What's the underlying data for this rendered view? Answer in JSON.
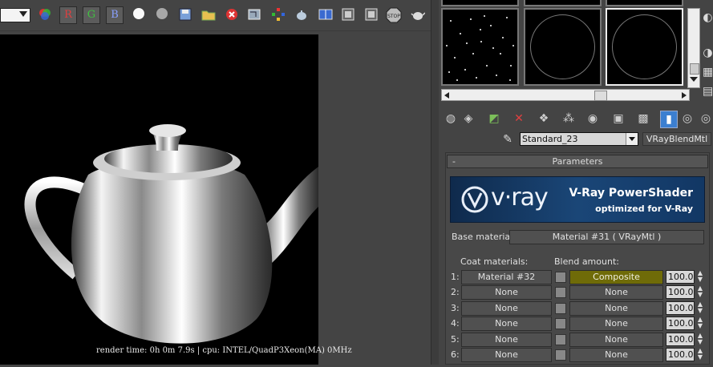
{
  "render_window": {
    "channels": {
      "r": "R",
      "g": "G",
      "b": "B"
    },
    "status_text": "render time:  0h  0m  7.9s | cpu: INTEL/QuadP3Xeon(MA) 0MHz"
  },
  "material_editor": {
    "material_name": "Standard_23",
    "material_type": "VRayBlendMtl",
    "rollout_title": "Parameters",
    "rollout_toggle": "-",
    "banner": {
      "logo": "v·ray",
      "title": "V-Ray PowerShader",
      "subtitle": "optimized for V-Ray"
    },
    "base_material_label": "Base material:",
    "base_material_value": "Material #31  ( VRayMtl )",
    "coat_header": "Coat materials:",
    "blend_header": "Blend amount:",
    "coats": [
      {
        "index": "1:",
        "material": "Material #32",
        "blend": "Composite",
        "amount": "100.0"
      },
      {
        "index": "2:",
        "material": "None",
        "blend": "None",
        "amount": "100.0"
      },
      {
        "index": "3:",
        "material": "None",
        "blend": "None",
        "amount": "100.0"
      },
      {
        "index": "4:",
        "material": "None",
        "blend": "None",
        "amount": "100.0"
      },
      {
        "index": "5:",
        "material": "None",
        "blend": "None",
        "amount": "100.0"
      },
      {
        "index": "6:",
        "material": "None",
        "blend": "None",
        "amount": "100.0"
      }
    ]
  },
  "colors": {
    "highlight": "#6f6b08",
    "banner_blue": "#1a4677",
    "active_tool": "#3c7fd0"
  }
}
